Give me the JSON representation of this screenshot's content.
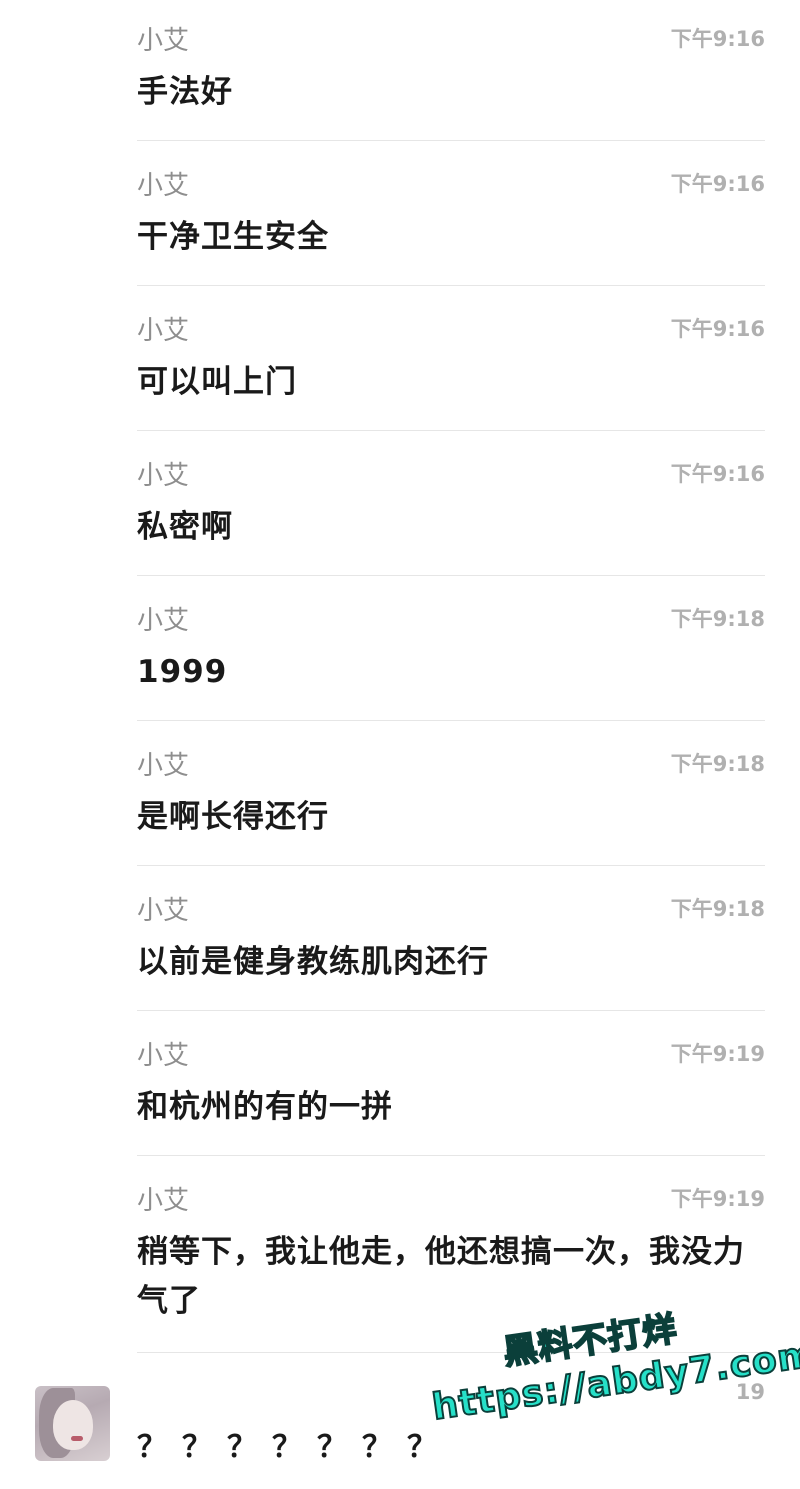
{
  "messages": [
    {
      "sender": "小艾",
      "time": "下午9:16",
      "text": "手法好"
    },
    {
      "sender": "小艾",
      "time": "下午9:16",
      "text": "干净卫生安全"
    },
    {
      "sender": "小艾",
      "time": "下午9:16",
      "text": "可以叫上门"
    },
    {
      "sender": "小艾",
      "time": "下午9:16",
      "text": "私密啊"
    },
    {
      "sender": "小艾",
      "time": "下午9:18",
      "text": "1999"
    },
    {
      "sender": "小艾",
      "time": "下午9:18",
      "text": "是啊长得还行"
    },
    {
      "sender": "小艾",
      "time": "下午9:18",
      "text": "以前是健身教练肌肉还行"
    },
    {
      "sender": "小艾",
      "time": "下午9:19",
      "text": "和杭州的有的一拼"
    },
    {
      "sender": "小艾",
      "time": "下午9:19",
      "text": "稍等下，我让他走，他还想搞一次，我没力气了"
    }
  ],
  "last_message": {
    "text": "？？？？？？？",
    "time": "19"
  },
  "watermark": {
    "line1": "黑料不打烊",
    "line2": "https://abdy7.com"
  }
}
